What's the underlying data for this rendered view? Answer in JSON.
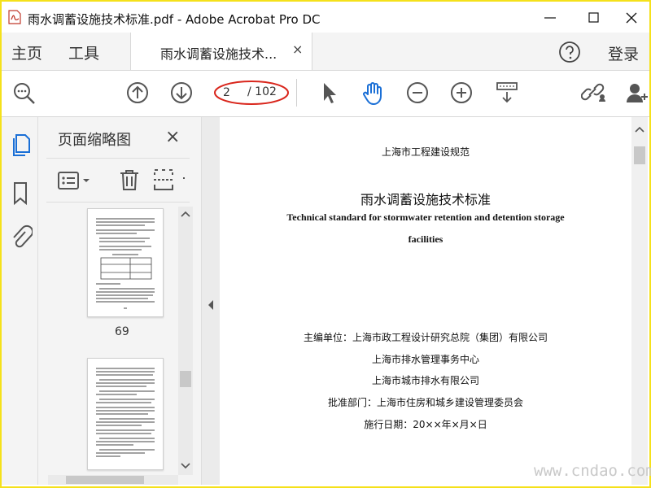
{
  "window": {
    "title": "雨水调蓄设施技术标准.pdf - Adobe Acrobat Pro DC"
  },
  "menu": {
    "home": "主页",
    "tools": "工具",
    "tab_label": "雨水调蓄设施技术...",
    "tab_close": "×",
    "login": "登录"
  },
  "toolbar": {
    "current_page": "2",
    "total_pages": "/ 102"
  },
  "panel": {
    "title": "页面缩略图",
    "close": "×",
    "thumb_label": "69"
  },
  "document": {
    "line1": "上海市工程建设规范",
    "line2": "雨水调蓄设施技术标准",
    "line3": "Technical standard for stormwater retention and detention storage",
    "line4": "facilities",
    "line5": "主编单位：上海市政工程设计研究总院（集团）有限公司",
    "line6": "上海市排水管理事务中心",
    "line7": "上海市城市排水有限公司",
    "line8": "批准部门：上海市住房和城乡建设管理委员会",
    "line9": "施行日期：20××年×月×日"
  },
  "watermark": "www.cndao.com",
  "colors": {
    "accent_blue": "#1a6fd6",
    "annotation_red": "#d9261c",
    "frame_yellow": "#f5e11a"
  }
}
